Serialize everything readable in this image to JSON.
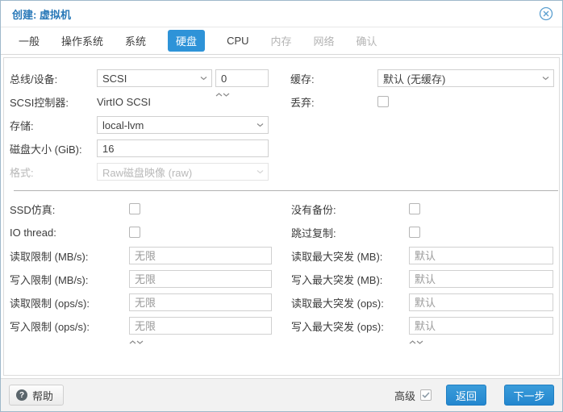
{
  "window": {
    "title": "创建: 虚拟机"
  },
  "colors": {
    "accent_blue": "#2e93d8",
    "title_blue": "#2878b8"
  },
  "tabs": {
    "items": [
      {
        "label": "一般",
        "state": "enabled"
      },
      {
        "label": "操作系统",
        "state": "enabled"
      },
      {
        "label": "系统",
        "state": "enabled"
      },
      {
        "label": "硬盘",
        "state": "active"
      },
      {
        "label": "CPU",
        "state": "enabled"
      },
      {
        "label": "内存",
        "state": "disabled"
      },
      {
        "label": "网络",
        "state": "disabled"
      },
      {
        "label": "确认",
        "state": "disabled"
      }
    ]
  },
  "fields": {
    "bus_device": {
      "label": "总线/设备:",
      "value": "SCSI",
      "number": "0"
    },
    "scsi_controller": {
      "label": "SCSI控制器:",
      "value": "VirtIO SCSI"
    },
    "storage": {
      "label": "存储:",
      "value": "local-lvm"
    },
    "disk_size": {
      "label": "磁盘大小 (GiB):",
      "value": "16"
    },
    "format": {
      "label": "格式:",
      "value": "Raw磁盘映像 (raw)",
      "state": "disabled"
    },
    "cache": {
      "label": "缓存:",
      "value": "默认 (无缓存)"
    },
    "discard": {
      "label": "丢弃:",
      "checked": false
    },
    "ssd_emulation": {
      "label": "SSD仿真:",
      "checked": false
    },
    "io_thread": {
      "label": "IO thread:",
      "checked": false
    },
    "read_limit_mb": {
      "label": "读取限制 (MB/s):",
      "placeholder": "无限"
    },
    "write_limit_mb": {
      "label": "写入限制 (MB/s):",
      "placeholder": "无限"
    },
    "read_limit_ops": {
      "label": "读取限制 (ops/s):",
      "placeholder": "无限"
    },
    "write_limit_ops": {
      "label": "写入限制 (ops/s):",
      "placeholder": "无限"
    },
    "no_backup": {
      "label": "没有备份:",
      "checked": false
    },
    "skip_replication": {
      "label": "跳过复制:",
      "checked": false
    },
    "read_burst_mb": {
      "label": "读取最大突发 (MB):",
      "placeholder": "默认"
    },
    "write_burst_mb": {
      "label": "写入最大突发 (MB):",
      "placeholder": "默认"
    },
    "read_burst_ops": {
      "label": "读取最大突发 (ops):",
      "placeholder": "默认"
    },
    "write_burst_ops": {
      "label": "写入最大突发 (ops):",
      "placeholder": "默认"
    }
  },
  "footer": {
    "help_label": "帮助",
    "help_icon_glyph": "?",
    "advanced_label": "高级",
    "advanced_checked": true,
    "back_label": "返回",
    "next_label": "下一步"
  }
}
